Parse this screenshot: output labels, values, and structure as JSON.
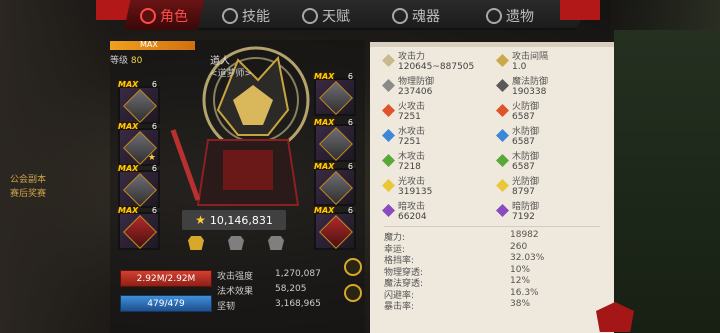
{
  "tabs": [
    {
      "label": "角色",
      "active": true
    },
    {
      "label": "技能",
      "active": false
    },
    {
      "label": "天赋",
      "active": false
    },
    {
      "label": "魂器",
      "active": false
    },
    {
      "label": "遗物",
      "active": false
    }
  ],
  "character": {
    "xp_label": "MAX",
    "level_label": "等级",
    "level_value": "80",
    "name": "道人",
    "subtitle": "<道萝师>",
    "power": "10,146,831"
  },
  "equipment_left": [
    {
      "badge": "MAX",
      "count": "6"
    },
    {
      "badge": "MAX",
      "count": "6",
      "star": "★"
    },
    {
      "badge": "MAX",
      "count": "6"
    },
    {
      "badge": "MAX",
      "count": "6"
    }
  ],
  "equipment_right": [
    {
      "badge": "MAX",
      "count": "6"
    },
    {
      "badge": "MAX",
      "count": "6"
    },
    {
      "badge": "MAX",
      "count": "6"
    },
    {
      "badge": "MAX",
      "count": "6"
    }
  ],
  "vitals": {
    "hp": "2.92M/2.92M",
    "mp": "479/479"
  },
  "basic_stats": [
    {
      "label": "攻击强度",
      "value": "1,270,087"
    },
    {
      "label": "法术效果",
      "value": "58,205"
    },
    {
      "label": "坚韧",
      "value": "3,168,965"
    }
  ],
  "detail_stats": [
    {
      "label": "攻击力",
      "value": "120645~887505",
      "icon_color": "#c9b98f"
    },
    {
      "label": "攻击间隔",
      "value": "1.0",
      "icon_color": "#c9a94a"
    },
    {
      "label": "物理防御",
      "value": "237406",
      "icon_color": "#8a8a8a"
    },
    {
      "label": "魔法防御",
      "value": "190338",
      "icon_color": "#5a5a5a"
    },
    {
      "label": "火攻击",
      "value": "7251",
      "icon_color": "#e0522a"
    },
    {
      "label": "火防御",
      "value": "6587",
      "icon_color": "#e0522a"
    },
    {
      "label": "水攻击",
      "value": "7251",
      "icon_color": "#3e86d8"
    },
    {
      "label": "水防御",
      "value": "6587",
      "icon_color": "#3e86d8"
    },
    {
      "label": "木攻击",
      "value": "7218",
      "icon_color": "#5aa83a"
    },
    {
      "label": "木防御",
      "value": "6587",
      "icon_color": "#5aa83a"
    },
    {
      "label": "光攻击",
      "value": "319135",
      "icon_color": "#e8c83a"
    },
    {
      "label": "光防御",
      "value": "8797",
      "icon_color": "#e8c83a"
    },
    {
      "label": "暗攻击",
      "value": "66204",
      "icon_color": "#8a4ac0"
    },
    {
      "label": "暗防御",
      "value": "7192",
      "icon_color": "#8a4ac0"
    }
  ],
  "other_stats": [
    {
      "label": "魔力:",
      "value": "18982"
    },
    {
      "label": "幸运:",
      "value": "260"
    },
    {
      "label": "格挡率:",
      "value": "32.03%"
    },
    {
      "label": "物理穿透:",
      "value": "10%"
    },
    {
      "label": "魔法穿透:",
      "value": "12%"
    },
    {
      "label": "闪避率:",
      "value": "16.3%"
    },
    {
      "label": "暴击率:",
      "value": "38%"
    }
  ],
  "side_text": [
    "公会副本",
    "赛后奖赛"
  ]
}
